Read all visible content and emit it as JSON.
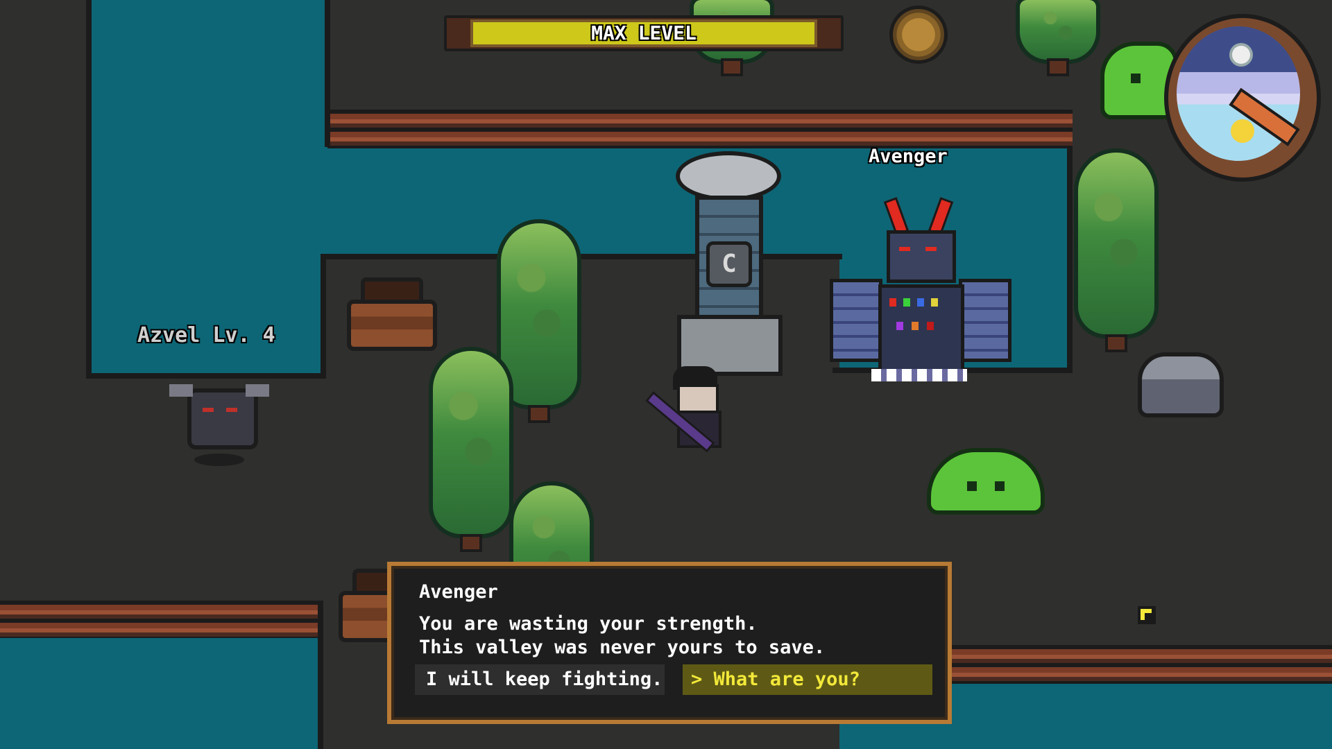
{
  "hud": {
    "xp_bar_label": "MAX LEVEL",
    "xp_fraction": 1.0
  },
  "entities": {
    "boss_name": "Avenger",
    "enemy_label": "Azvel Lv. 4",
    "pillar_glyph": "C"
  },
  "dialog": {
    "speaker": "Avenger",
    "line1": "You are wasting your strength.",
    "line2": "This valley was never yours to save.",
    "options": [
      {
        "label": "I will keep fighting.",
        "selected": false
      },
      {
        "prefix": ">",
        "label": "What are you?",
        "selected": true
      }
    ]
  },
  "colors": {
    "water": "#0d6676",
    "ground": "#2f2f2d",
    "xp_fill": "#cdc81a",
    "dialog_border": "#b87a35",
    "selected_option_text": "#f3e93a"
  },
  "icons": [
    "coin-icon",
    "day-night-clock-icon",
    "pointer-cursor-icon",
    "pillar-c-rune-icon"
  ]
}
